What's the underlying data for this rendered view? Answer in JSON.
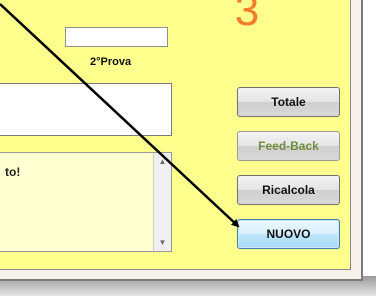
{
  "header": {
    "big_number": "3"
  },
  "prova": {
    "label": "2°Prova",
    "value": ""
  },
  "textbox": {
    "value": ""
  },
  "memo": {
    "text": "to!"
  },
  "buttons": {
    "totale": "Totale",
    "feedback": "Feed-Back",
    "ricalcola": "Ricalcola",
    "nuovo": "NUOVO"
  },
  "icons": {
    "scroll_up": "scroll-up-arrow-icon",
    "scroll_down": "scroll-down-arrow-icon",
    "annotation": "annotation-arrow"
  },
  "colors": {
    "panel_background": "#ffff8e",
    "big_number": "#f77a2a",
    "feedback_text": "#6e8c3c",
    "nuovo_highlight": "#3c7fb1"
  }
}
